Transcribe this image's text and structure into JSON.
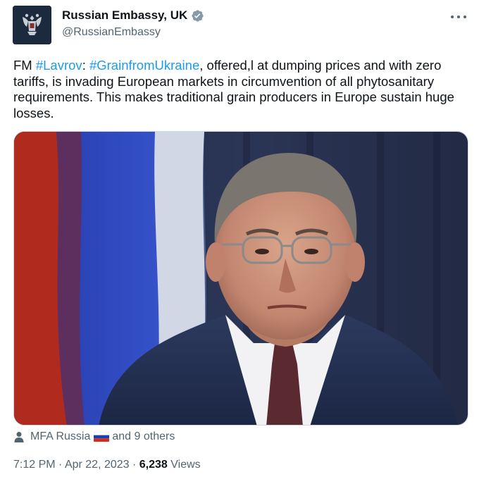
{
  "author": {
    "display_name": "Russian Embassy, UK",
    "handle": "@RussianEmbassy",
    "avatar_icon": "coat-of-arms-icon",
    "verified_icon": "verified-badge-icon"
  },
  "tweet": {
    "prefix": "FM ",
    "hashtag_1": "#Lavrov",
    "sep": ": ",
    "hashtag_2": "#GrainfromUkraine",
    "body": ", offered,l at dumping prices and with zero tariffs, is invading European markets in circumvention of all phytosanitary requirements.  This makes traditional grain producers in Europe sustain huge losses."
  },
  "media": {
    "icon": "photo-portrait"
  },
  "tags": {
    "person_icon": "person-icon",
    "first_tag": "MFA Russia",
    "flag_icon": "russian-flag-icon",
    "others": "and 9 others"
  },
  "meta": {
    "time": "7:12 PM",
    "dot": " · ",
    "date": "Apr 22, 2023",
    "dot2": " · ",
    "views_count": "6,238",
    "views_label": " Views"
  },
  "colors": {
    "link": "#1d9bf0",
    "secondary_text": "#536471",
    "verified": "#829aab"
  }
}
